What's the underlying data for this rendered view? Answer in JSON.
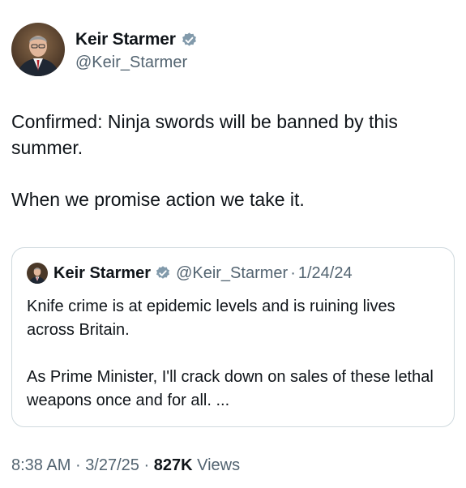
{
  "author": {
    "display_name": "Keir Starmer",
    "handle": "@Keir_Starmer",
    "verified_icon": "verified-badge-icon",
    "badge_color": "#829aab"
  },
  "tweet": {
    "paragraphs": [
      "Confirmed: Ninja swords will be banned by this summer.",
      "When we promise action we take it."
    ]
  },
  "quote": {
    "display_name": "Keir Starmer",
    "handle": "@Keir_Starmer",
    "separator": "·",
    "date": "1/24/24",
    "paragraphs": [
      "Knife crime is at epidemic levels and is ruining lives across Britain.",
      "As Prime Minister, I'll crack down on sales of these lethal weapons once and for all. ..."
    ]
  },
  "meta": {
    "time": "8:38 AM",
    "separator": "·",
    "date": "3/27/25",
    "views_count": "827K",
    "views_label": "Views"
  }
}
